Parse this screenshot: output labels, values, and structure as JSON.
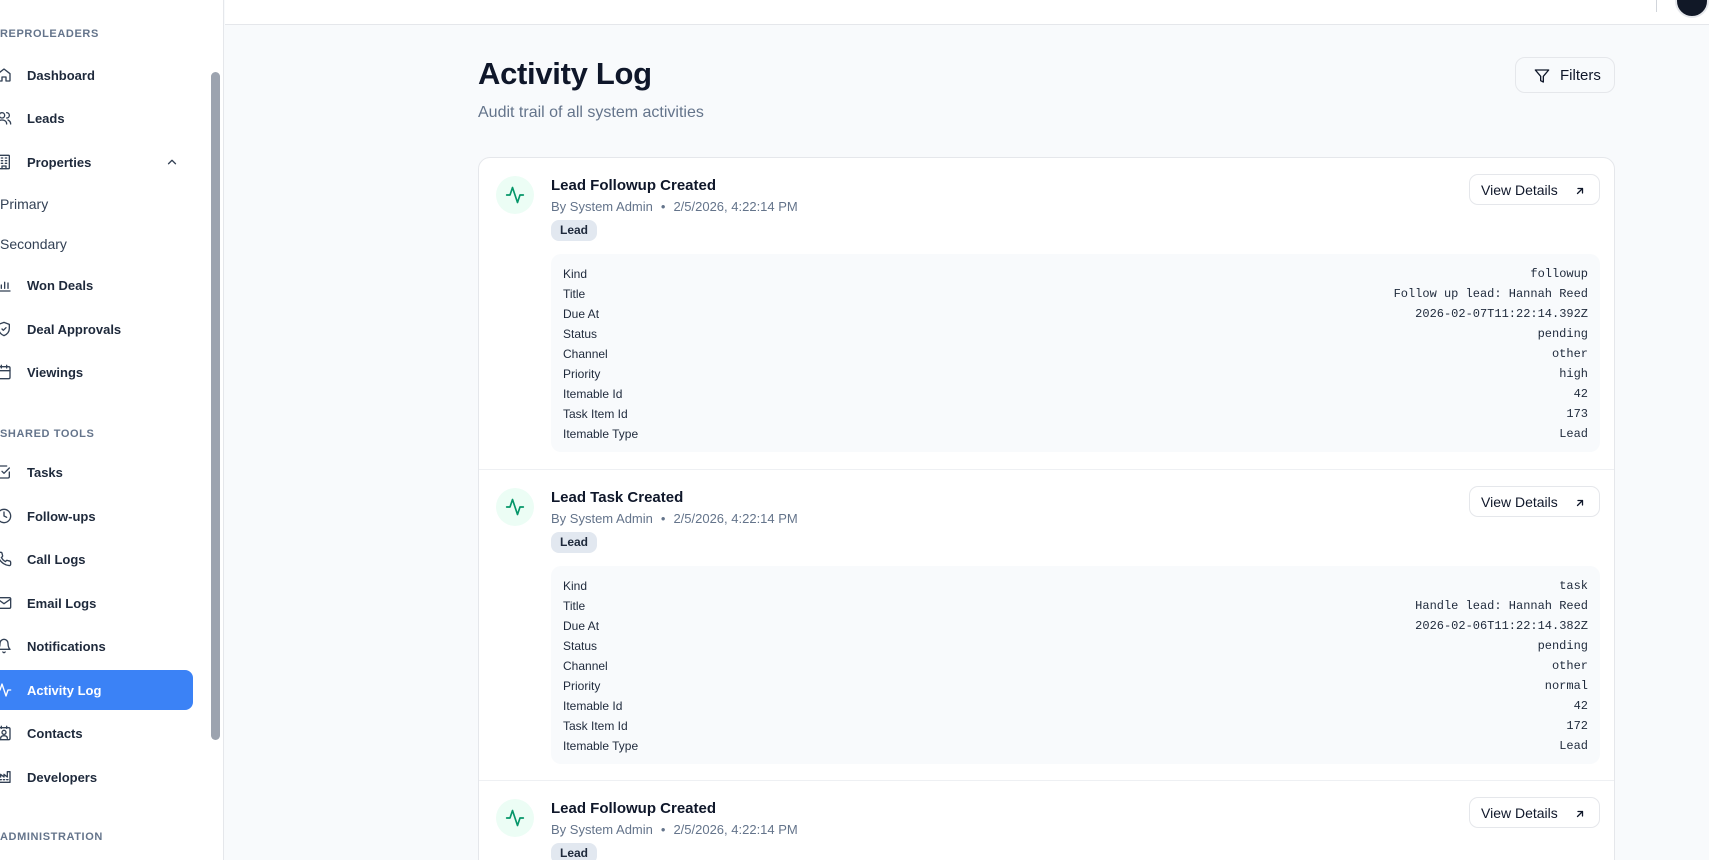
{
  "sidebar": {
    "sections": [
      {
        "label": "REPROLEADERS"
      },
      {
        "label": "SHARED TOOLS"
      },
      {
        "label": "ADMINISTRATION"
      }
    ],
    "items": [
      {
        "label": "Dashboard",
        "icon": "home-icon"
      },
      {
        "label": "Leads",
        "icon": "users-icon"
      },
      {
        "label": "Properties",
        "icon": "building-icon"
      },
      {
        "label": "Won Deals",
        "icon": "bar-chart-icon"
      },
      {
        "label": "Deal Approvals",
        "icon": "shield-check-icon"
      },
      {
        "label": "Viewings",
        "icon": "calendar-icon"
      },
      {
        "label": "Tasks",
        "icon": "check-square-icon"
      },
      {
        "label": "Follow-ups",
        "icon": "clock-icon"
      },
      {
        "label": "Call Logs",
        "icon": "phone-icon"
      },
      {
        "label": "Email Logs",
        "icon": "mail-icon"
      },
      {
        "label": "Notifications",
        "icon": "bell-icon"
      },
      {
        "label": "Activity Log",
        "icon": "activity-icon",
        "active": true
      },
      {
        "label": "Contacts",
        "icon": "contact-icon"
      },
      {
        "label": "Developers",
        "icon": "factory-icon"
      }
    ],
    "property_subitems": [
      "Primary",
      "Secondary"
    ]
  },
  "header": {
    "title": "Activity Log",
    "subtitle": "Audit trail of all system activities",
    "filters_label": "Filters"
  },
  "activities": [
    {
      "title": "Lead Followup Created",
      "actor": "By System Admin",
      "timestamp": "2/5/2026, 4:22:14 PM",
      "badge": "Lead",
      "view_label": "View Details",
      "details": [
        {
          "key": "Kind",
          "value": "followup"
        },
        {
          "key": "Title",
          "value": "Follow up lead: Hannah Reed"
        },
        {
          "key": "Due At",
          "value": "2026-02-07T11:22:14.392Z"
        },
        {
          "key": "Status",
          "value": "pending"
        },
        {
          "key": "Channel",
          "value": "other"
        },
        {
          "key": "Priority",
          "value": "high"
        },
        {
          "key": "Itemable Id",
          "value": "42"
        },
        {
          "key": "Task Item Id",
          "value": "173"
        },
        {
          "key": "Itemable Type",
          "value": "Lead"
        }
      ]
    },
    {
      "title": "Lead Task Created",
      "actor": "By System Admin",
      "timestamp": "2/5/2026, 4:22:14 PM",
      "badge": "Lead",
      "view_label": "View Details",
      "details": [
        {
          "key": "Kind",
          "value": "task"
        },
        {
          "key": "Title",
          "value": "Handle lead: Hannah Reed"
        },
        {
          "key": "Due At",
          "value": "2026-02-06T11:22:14.382Z"
        },
        {
          "key": "Status",
          "value": "pending"
        },
        {
          "key": "Channel",
          "value": "other"
        },
        {
          "key": "Priority",
          "value": "normal"
        },
        {
          "key": "Itemable Id",
          "value": "42"
        },
        {
          "key": "Task Item Id",
          "value": "172"
        },
        {
          "key": "Itemable Type",
          "value": "Lead"
        }
      ]
    },
    {
      "title": "Lead Followup Created",
      "actor": "By System Admin",
      "timestamp": "2/5/2026, 4:22:14 PM",
      "badge": "Lead",
      "view_label": "View Details",
      "details": []
    }
  ],
  "colors": {
    "accent": "#3b82f6",
    "activity_icon": "#059669",
    "activity_icon_bg": "#ecfdf5"
  }
}
